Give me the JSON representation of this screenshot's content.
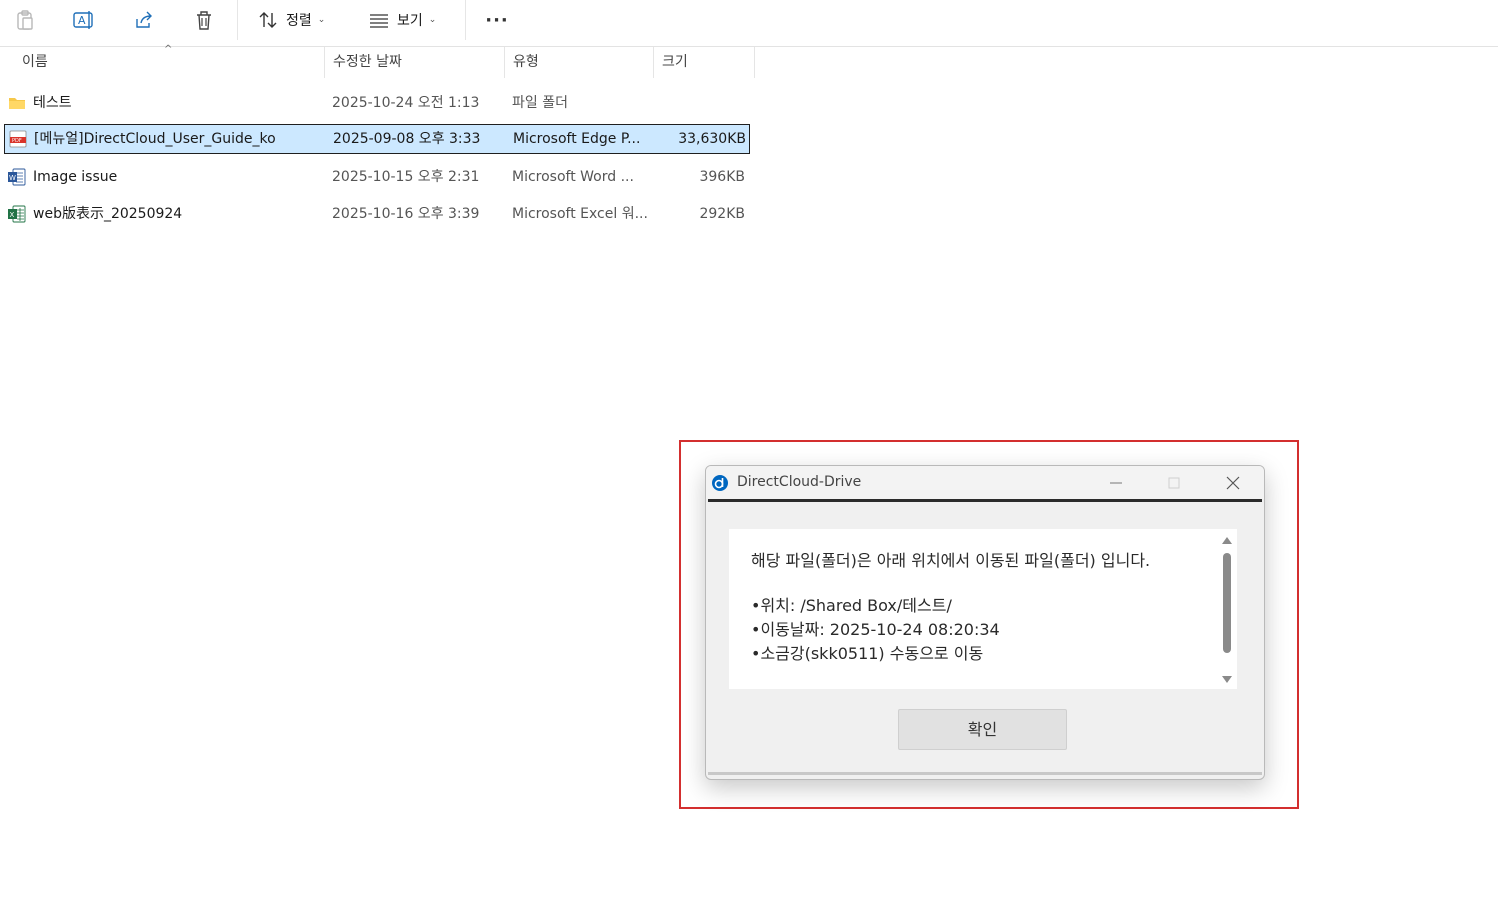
{
  "toolbar": {
    "sort_label": "정렬",
    "view_label": "보기",
    "more_label": "···",
    "icons": [
      "clipboard-icon",
      "rename-icon",
      "share-icon",
      "delete-icon",
      "sort-icon",
      "view-icon",
      "more-icon"
    ]
  },
  "columns": {
    "name": "이름",
    "date": "수정한 날짜",
    "type": "유형",
    "size": "크기"
  },
  "files": [
    {
      "name": "테스트",
      "date": "2025-10-24 오전 1:13",
      "type": "파일 폴더",
      "size": "",
      "icon": "folder-icon",
      "selected": false
    },
    {
      "name": "[메뉴얼]DirectCloud_User_Guide_ko",
      "date": "2025-09-08 오후 3:33",
      "type": "Microsoft Edge P...",
      "size": "33,630KB",
      "icon": "pdf-icon",
      "selected": true
    },
    {
      "name": "Image issue",
      "date": "2025-10-15 오후 2:31",
      "type": "Microsoft Word ...",
      "size": "396KB",
      "icon": "word-icon",
      "selected": false
    },
    {
      "name": "web版表示_20250924",
      "date": "2025-10-16 오후 3:39",
      "type": "Microsoft Excel 워...",
      "size": "292KB",
      "icon": "excel-icon",
      "selected": false
    }
  ],
  "dialog": {
    "title": "DirectCloud-Drive",
    "message_line1": "해당 파일(폴더)은 아래 위치에서 이동된 파일(폴더) 입니다.",
    "location": "•위치: /Shared Box/테스트/",
    "moved_date": "•이동날짜: 2025-10-24 08:20:34",
    "moved_by": "•소금강(skk0511) 수동으로 이동",
    "ok_label": "확인"
  },
  "colors": {
    "selection": "#cce8ff",
    "highlight_border": "#d32f2f",
    "folder": "#f6c84a",
    "pdf": "#d9342b",
    "word": "#2b579a",
    "excel": "#217346",
    "accent": "#0067c0"
  }
}
